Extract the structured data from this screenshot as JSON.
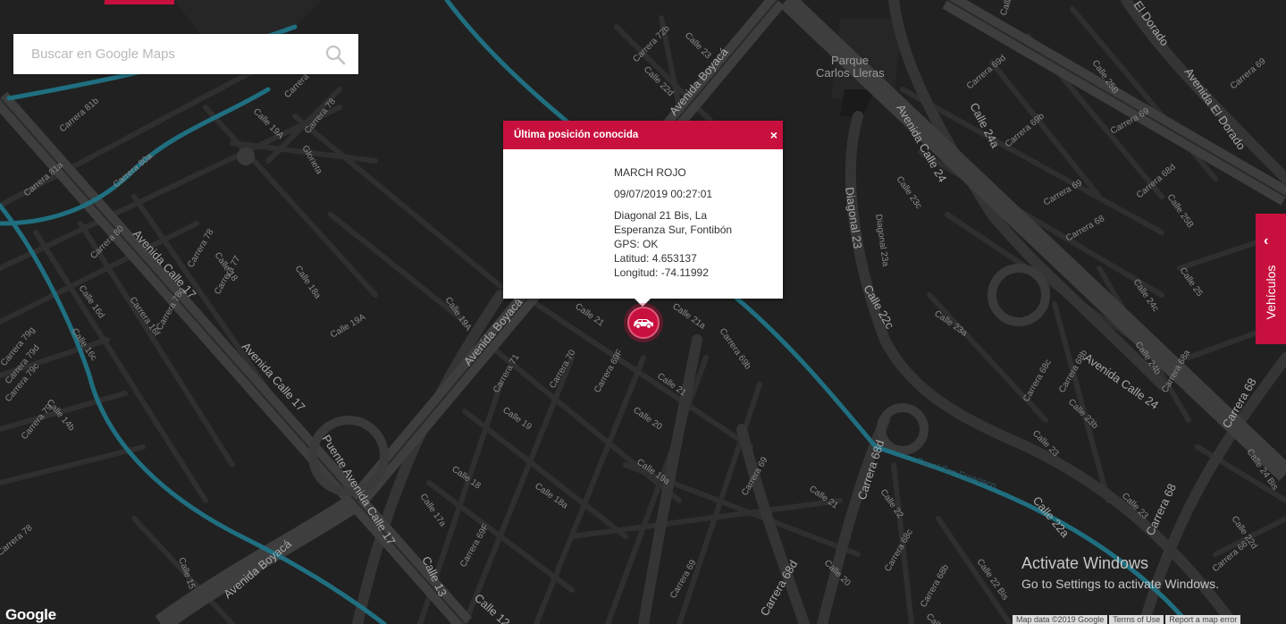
{
  "search": {
    "placeholder": "Buscar en Google Maps"
  },
  "popup": {
    "title": "Última posición conocida",
    "close": "×",
    "vehicle": "MARCH ROJO",
    "timestamp": "09/07/2019 00:27:01",
    "address_line1": "Diagonal 21 Bis, La",
    "address_line2": "Esperanza Sur, Fontibón",
    "gps": "GPS: OK",
    "lat": "Latitud: 4.653137",
    "lon": "Longitud: -74.11992"
  },
  "side_tab": {
    "label": "Vehículos",
    "chevron": "‹"
  },
  "google_logo": "Google",
  "watermark": {
    "line1": "Activate Windows",
    "line2": "Go to Settings to activate Windows."
  },
  "attribution": {
    "map_data": "Map data ©2019 Google",
    "terms": "Terms of Use",
    "report": "Report a map error"
  },
  "colors": {
    "accent": "#c8103e",
    "map_bg": "#212121",
    "road": "#3c3c3c",
    "canal": "#1f6f80"
  },
  "map_labels": {
    "parque_1": "Parque",
    "parque_2": "Carlos Lleras",
    "av_boyaca_a": "Avenida Boyacá",
    "av_boyaca_b": "Avenida Boyacá",
    "av_boyaca_c": "Avenida Boyacá",
    "av_calle17_a": "Avenida Calle 17",
    "av_calle17_b": "Avenida Calle 17",
    "puente": "Puente Avenida Calle 17",
    "av_calle24_a": "Avenida Calle 24",
    "av_calle24_b": "Avenida Calle 24",
    "av_eldorado": "Avenida El Dorado",
    "el_dorado": "El Dorado",
    "diagonal23": "Diagonal 23",
    "diagonal23a": "Diagonal 23a",
    "calle24a": "Calle 24a",
    "calle22c": "Calle 22c",
    "calle22a": "Calle 22a",
    "carrera68d_a": "Carrera 68d",
    "carrera68d_b": "Carrera 68d",
    "carrera68_a": "Carrera 68",
    "carrera68_b": "Carrera 68",
    "calle13": "Calle 13",
    "calle12": "Calle 12",
    "canal": "Canal San Francisco",
    "c72b": "Carrera 72b",
    "c23a": "Calle 23",
    "c22d": "Calle 22d",
    "c23b": "Calle 23",
    "c79": "Carrera 79",
    "c78": "Carrera 78",
    "c19a": "Calle 19A",
    "glorieta": "Glorieta",
    "c81b": "Carrera 81b",
    "c80a": "Carrera 80a",
    "c81a": "Carrera 81a",
    "c80": "Carrera 80",
    "c78b": "Carrera 78",
    "c77": "Carrera 77",
    "c18": "Calle 18",
    "c18a": "Calle 18a",
    "c16d": "Calle 16d",
    "c16f": "Carrera 16f",
    "c78g": "Carrera 78g",
    "c16c": "Calle 16c",
    "c19a2": "Calle 19A",
    "c19a3": "Calle 19A",
    "c21": "Calle 21",
    "c21a": "Calle 21a",
    "c69b": "Carrera 69b",
    "c71": "Carrera 71",
    "c70": "Carrera 70",
    "c69f": "Carrera 69F",
    "c21b": "Calle 21",
    "c19": "Calle 19",
    "c20": "Calle 20",
    "c19a4": "Calle 19a",
    "c18b": "Calle 18",
    "c18a2": "Calle 18a",
    "c17a": "Calle 17a",
    "c69f2": "Carrera 69F",
    "c69": "Carrera 69",
    "c21c": "Calle 21",
    "c69c": "Carrera 69",
    "c79g": "Carrera 79g",
    "c79d": "Carrera 79d",
    "c79c": "Carrera 79c",
    "c14b": "Calle 14b",
    "c79e": "Carrera 79",
    "c78c": "Carrera 78",
    "c15": "Calle 15",
    "c25": "Calle 25",
    "c69d": "Carrera 69d",
    "c25b": "Calle 25B",
    "c69e": "Carrera 69",
    "c69b2": "Carrera 69b",
    "c69g": "Carrera 69",
    "c68d": "Carrera 68d",
    "c25b2": "Calle 25B",
    "c25d": "Calle 25",
    "c24c": "Calle 24c",
    "c23a2": "Calle 23a",
    "c23c": "Calle 23c",
    "c24a": "Carrera 69",
    "c68e": "Carrera 68",
    "c68b": "Carrera 68b",
    "c68c": "Carrera 68c",
    "c23b2": "Calle 23b",
    "c24b": "Calle 24b",
    "c68a": "Carrera 68a",
    "c23d": "Calle 23",
    "c22": "Calle 22",
    "c68c2": "Carrera 68c",
    "c20b": "Calle 20",
    "c68b2": "Carrera 68b",
    "c21d": "Calle 21",
    "c23e": "Calle 23",
    "c22bis": "Calle 22 Bis",
    "c66": "Carrera 66",
    "c24bis": "Calle 24 Bis",
    "c22d2": "Calle 22d"
  }
}
